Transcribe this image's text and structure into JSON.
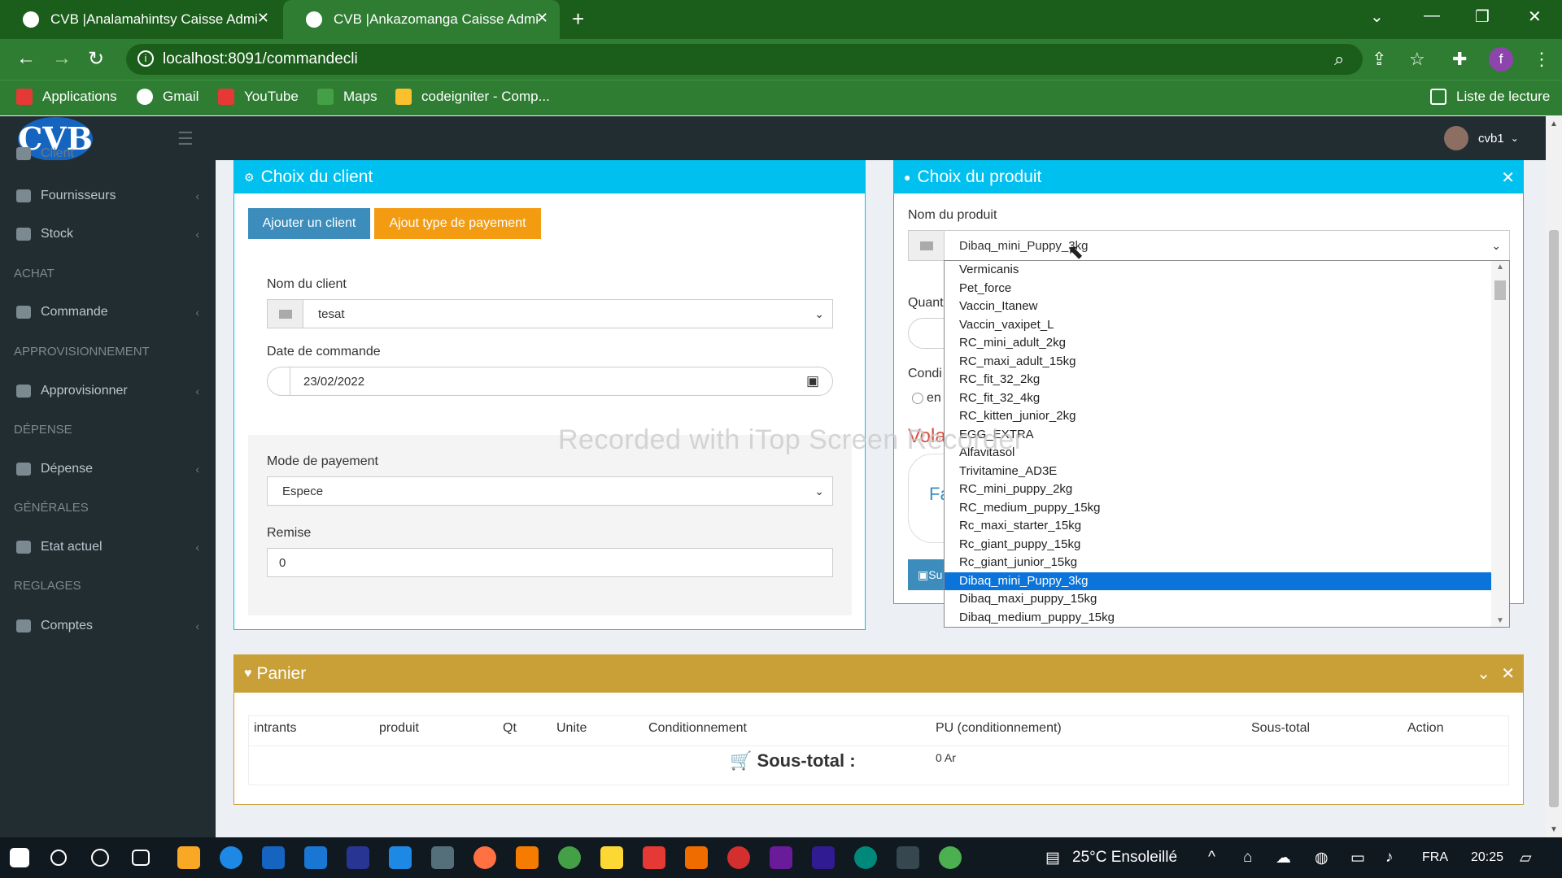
{
  "browser": {
    "tabs": [
      {
        "label": "CVB |Analamahintsy Caisse Admi",
        "active": false
      },
      {
        "label": "CVB |Ankazomanga Caisse Admi",
        "active": true
      }
    ],
    "url": "localhost:8091/commandecli",
    "bookmarks": [
      "Applications",
      "Gmail",
      "YouTube",
      "Maps",
      "codeigniter - Comp..."
    ],
    "reading_list": "Liste de lecture",
    "profile_letter": "f"
  },
  "header": {
    "logo": "CVB",
    "user": "cvb1"
  },
  "sidebar": {
    "items": [
      {
        "label": "Client",
        "type": "item"
      },
      {
        "label": "Fournisseurs",
        "type": "item"
      },
      {
        "label": "Stock",
        "type": "item"
      },
      {
        "label": "ACHAT",
        "type": "head"
      },
      {
        "label": "Commande",
        "type": "item"
      },
      {
        "label": "APPROVISIONNEMENT",
        "type": "head"
      },
      {
        "label": "Approvisionner",
        "type": "item"
      },
      {
        "label": "DÉPENSE",
        "type": "head"
      },
      {
        "label": "Dépense",
        "type": "item"
      },
      {
        "label": "GÉNÉRALES",
        "type": "head"
      },
      {
        "label": "Etat actuel",
        "type": "item"
      },
      {
        "label": "REGLAGES",
        "type": "head"
      },
      {
        "label": "Comptes",
        "type": "item"
      }
    ]
  },
  "client_box": {
    "title": "Choix du client",
    "add_client": "Ajouter un client",
    "add_payment_type": "Ajout type de payement",
    "client_label": "Nom du client",
    "client_value": "tesat",
    "date_label": "Date de commande",
    "date_value": "23/02/2022",
    "payment_label": "Mode de payement",
    "payment_value": "Espece",
    "discount_label": "Remise",
    "discount_value": "0"
  },
  "product_box": {
    "title": "Choix du produit",
    "product_label": "Nom du produit",
    "product_value": "Dibaq_mini_Puppy_3kg",
    "hidden_labels": [
      "Quant",
      "Condi",
      "en",
      "Vola",
      "Fa",
      "Su"
    ],
    "options": [
      "Vermicanis",
      "Pet_force",
      "Vaccin_Itanew",
      "Vaccin_vaxipet_L",
      "RC_mini_adult_2kg",
      "RC_maxi_adult_15kg",
      "RC_fit_32_2kg",
      "RC_fit_32_4kg",
      "RC_kitten_junior_2kg",
      "EGG_EXTRA",
      "Alfavitasol",
      "Trivitamine_AD3E",
      "RC_mini_puppy_2kg",
      "RC_medium_puppy_15kg",
      "Rc_maxi_starter_15kg",
      "Rc_giant_puppy_15kg",
      "Rc_giant_junior_15kg",
      "Dibaq_mini_Puppy_3kg",
      "Dibaq_maxi_puppy_15kg",
      "Dibaq_medium_puppy_15kg"
    ],
    "selected_index": 17
  },
  "panier": {
    "title": "Panier",
    "columns": [
      "intrants",
      "produit",
      "Qt",
      "Unite",
      "Conditionnement",
      "PU (conditionnement)",
      "Sous-total",
      "Action"
    ],
    "subtotal_label": "Sous-total :",
    "subtotal_value": "0 Ar"
  },
  "watermark": "Recorded with iTop Screen Recorder",
  "taskbar": {
    "weather": "25°C  Ensoleillé",
    "lang": "FRA",
    "time": "20:25"
  },
  "colors": {
    "browser_dark": "#1b5e1b",
    "browser": "#2e7d32",
    "sidebar": "#222d32",
    "info_header": "#00c0ef",
    "primary_button": "#3c8dbc",
    "warning_button": "#f39c12",
    "panier_header": "#c9a038",
    "dropdown_selected": "#0a74da"
  }
}
